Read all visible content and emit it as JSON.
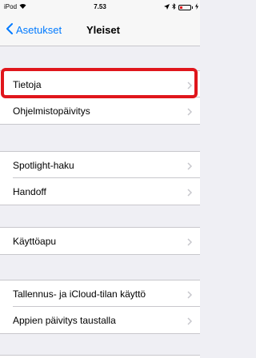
{
  "status_bar": {
    "carrier": "iPod",
    "time": "7.53"
  },
  "nav": {
    "back_label": "Asetukset",
    "title": "Yleiset"
  },
  "groups": [
    {
      "items": [
        {
          "label": "Tietoja",
          "highlighted": true
        },
        {
          "label": "Ohjelmistopäivitys"
        }
      ]
    },
    {
      "items": [
        {
          "label": "Spotlight-haku"
        },
        {
          "label": "Handoff"
        }
      ]
    },
    {
      "items": [
        {
          "label": "Käyttöapu"
        }
      ]
    },
    {
      "items": [
        {
          "label": "Tallennus- ja iCloud-tilan käyttö"
        },
        {
          "label": "Appien päivitys taustalla"
        }
      ]
    }
  ],
  "colors": {
    "accent": "#007aff",
    "highlight": "#e0161c",
    "background": "#efeff4"
  }
}
